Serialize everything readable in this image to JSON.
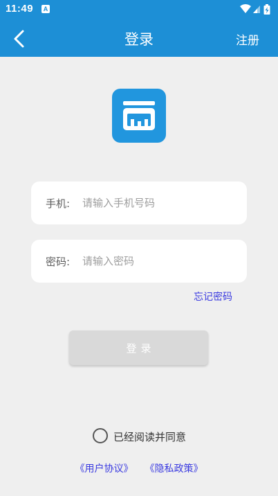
{
  "status_bar": {
    "time": "11:49",
    "notification_icon": "A",
    "icons": [
      "wifi-icon",
      "signal-icon",
      "battery-charging-icon"
    ]
  },
  "header": {
    "back_icon": "chevron-left-icon",
    "title": "登录",
    "register_label": "注册"
  },
  "logo_icon": "app-logo-icon",
  "form": {
    "phone": {
      "label": "手机:",
      "placeholder": "请输入手机号码",
      "value": ""
    },
    "password": {
      "label": "密码:",
      "placeholder": "请输入密码",
      "value": ""
    },
    "forgot_label": "忘记密码",
    "login_label": "登录"
  },
  "agreement": {
    "checked": false,
    "text": "已经阅读并同意",
    "user_agreement": "《用户协议》",
    "privacy_policy": "《隐私政策》"
  },
  "colors": {
    "header_bg": "#1d8fd6",
    "logo_bg": "#2196de",
    "link": "#3a3ae0",
    "button_disabled": "#d9d9d9",
    "page_bg": "#efefef"
  }
}
